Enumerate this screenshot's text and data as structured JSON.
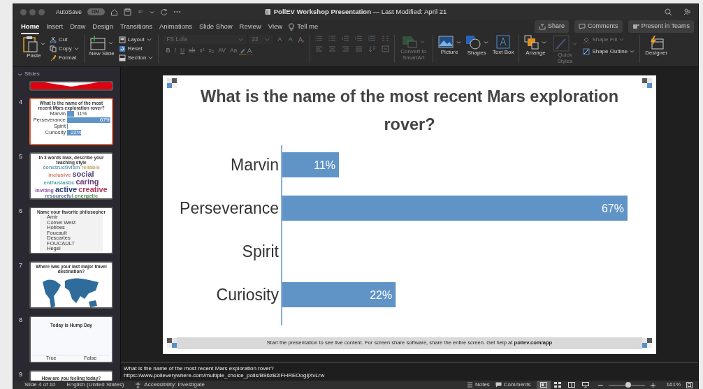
{
  "title_bar": {
    "autosave_label": "AutoSave",
    "autosave_toggle": {
      "text": "ON",
      "on": true
    },
    "title": "**PollEV Workshop Presentation** — Last Modified: April 21"
  },
  "tabs": [
    {
      "label": "Home",
      "selected": true
    },
    {
      "label": "Insert",
      "selected": false
    },
    {
      "label": "Draw",
      "selected": false
    },
    {
      "label": "Design",
      "selected": false
    },
    {
      "label": "Transitions",
      "selected": false
    },
    {
      "label": "Animations",
      "selected": false
    },
    {
      "label": "Slide Show",
      "selected": false
    },
    {
      "label": "Review",
      "selected": false
    },
    {
      "label": "View",
      "selected": false
    }
  ],
  "tell_me": "Tell me",
  "actions": [
    "Share",
    "Comments",
    "Present in Teams"
  ],
  "ribbon": {
    "clipboard": {
      "paste": "Paste",
      "cut": "Cut",
      "copy": "Copy",
      "format": "Format"
    },
    "slides": {
      "new_slide": "New Slide",
      "layout": "Layout",
      "reset": "Reset",
      "section": "Section"
    },
    "font": {
      "disabled": true,
      "font_name": "FS Lola",
      "font_size": "22",
      "size_buttons": [
        "A",
        "A"
      ],
      "style_buttons": [
        "B",
        "I",
        "U",
        "ab",
        "x²",
        "x₂",
        "AV",
        "Aa"
      ]
    },
    "paragraph": {
      "disabled": true
    },
    "convert": {
      "label": "Convert to SmartArt",
      "disabled": true
    },
    "insert": {
      "picture": "Picture",
      "shapes": "Shapes",
      "text_box": "Text Box"
    },
    "arrange": {
      "arrange": {
        "label": "Arrange",
        "disabled": false
      },
      "quick_styles": {
        "label": "Quick Styles",
        "disabled": true
      },
      "shape_fill": {
        "label": "Shape Fill",
        "disabled": true
      },
      "shape_outline": {
        "label": "Shape Outline",
        "disabled": false
      }
    },
    "designer": "Designer"
  },
  "slides_panel": {
    "header": "Slides",
    "expanded": true,
    "thumbnails": [
      {
        "kind": "partial",
        "selected": false
      },
      {
        "kind": "chart",
        "number": "4",
        "selected": true,
        "title": "What is the name of the most recent Mars exploration rover?",
        "bars": [
          {
            "label": "Marvin",
            "level": 0.16,
            "value": "11%"
          },
          {
            "label": "Perseverance",
            "level": 1.0,
            "value": "67%"
          },
          {
            "label": "Spirit",
            "level": 0
          },
          {
            "label": "Curiosity",
            "level": 0.33,
            "value": "22%"
          }
        ]
      },
      {
        "kind": "wordcloud",
        "number": "5",
        "selected": false,
        "title": "In 3 words max, describe your teaching style",
        "words": [
          {
            "text": "constructivism",
            "color": "#6a9fb5",
            "large": false
          },
          {
            "text": "reliable",
            "color": "#c9a36a",
            "large": false
          },
          {
            "text": "inclusive",
            "color": "#c97c6a",
            "large": false
          },
          {
            "text": "social",
            "color": "#4f3f7a",
            "large": true
          },
          {
            "text": "enthusiastic",
            "color": "#4aa3a0",
            "large": false
          },
          {
            "text": "caring",
            "color": "#6b3a7a",
            "large": true
          },
          {
            "text": "inviting",
            "color": "#8a4f9a",
            "large": false
          },
          {
            "text": "active",
            "color": "#2f3f7a",
            "large": true
          },
          {
            "text": "creative",
            "color": "#b03a5a",
            "large": true
          },
          {
            "text": "resourceful",
            "color": "#4a6f9a",
            "large": false
          },
          {
            "text": "energetic",
            "color": "#4f8a4a",
            "large": false
          }
        ]
      },
      {
        "kind": "list",
        "number": "6",
        "selected": false,
        "title": "Name your favorite philosopher",
        "items": [
          "Amir",
          "Cornel West",
          "Hobbes",
          "Foucault",
          "Descartes",
          "FOUCAULT",
          "Hegel"
        ]
      },
      {
        "kind": "map",
        "number": "7",
        "selected": false,
        "title": "Where was your last major travel destination?"
      },
      {
        "kind": "truefalse",
        "number": "8",
        "selected": false,
        "title": "Today is Hump Day",
        "options": [
          "True",
          "False"
        ]
      },
      {
        "kind": "title",
        "number": "9",
        "selected": false,
        "title": "How are you feeling today?"
      }
    ]
  },
  "slide": {
    "title": "What is the name of the most recent Mars exploration rover?",
    "chart_data": {
      "type": "bar",
      "orientation": "horizontal",
      "categories": [
        "Marvin",
        "Perseverance",
        "Spirit",
        "Curiosity"
      ],
      "values": [
        11,
        67,
        0,
        22
      ],
      "value_labels": [
        "11%",
        "67%",
        null,
        "22%"
      ]
    },
    "footer": "Start the presentation to see live content. For screen share software, share the entire screen. Get help at **pollev.com/app**"
  },
  "notes": [
    "What is the name of the most recent Mars exploration rover?",
    "https://www.polleverywhere.com/multiple_choice_polls/B96zB2iFHREOogljXvLrw"
  ],
  "status_bar": {
    "slide_info": "Slide 4 of 10",
    "language": "English (United States)",
    "accessibility": "Accessibility: Investigate",
    "notes": "Notes",
    "comments": "Comments",
    "views": [
      {
        "selected": true
      },
      {
        "selected": false
      },
      {
        "selected": false
      },
      {
        "selected": false
      }
    ],
    "zoom": {
      "level": 0.55,
      "reading": "161%"
    }
  }
}
